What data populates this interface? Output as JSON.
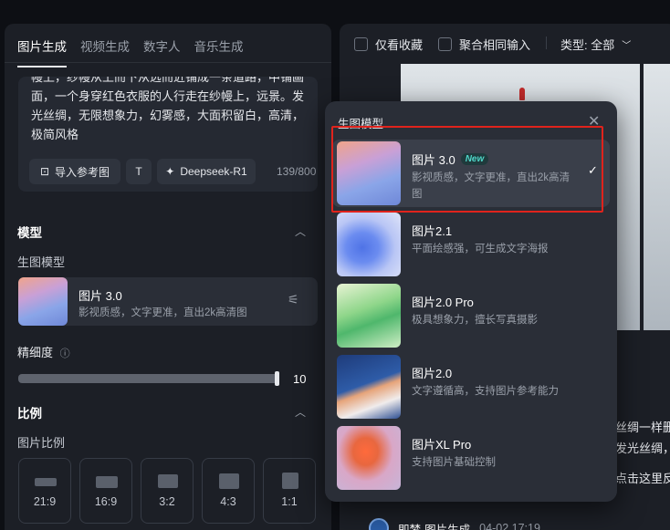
{
  "tabs": [
    "图片生成",
    "视频生成",
    "数字人",
    "音乐生成"
  ],
  "prompt": {
    "text": "幔上，纱幔从上而下从远而近铺成一条道路，中铺画面，一个身穿红色衣服的人行走在纱幔上，远景。发光丝绸，无限想象力，幻雾感，大面积留白，高清，极简风格",
    "import_label": "导入参考图",
    "model_label": "Deepseek-R1",
    "char_count": "139/800"
  },
  "model_section": {
    "title": "模型",
    "sub_label": "生图模型",
    "selected_name": "图片 3.0",
    "selected_desc": "影视质感，文字更准，直出2k高清图"
  },
  "detail": {
    "label": "精细度",
    "value": "10",
    "level_fraction": 0.95
  },
  "ratio_section": {
    "title": "比例",
    "sub_label": "图片比例",
    "ratios": [
      "21:9",
      "16:9",
      "3:2",
      "4:3",
      "1:1"
    ]
  },
  "right": {
    "filter_collect": "仅看收藏",
    "filter_merge": "聚合相同输入",
    "type_filter": "类型: 全部",
    "side_text_1": "丝绸一样删",
    "side_text_2": "发光丝绸，",
    "side_text_3": "点击这里反",
    "footer_name": "即梦-图片生成",
    "footer_time": "04-02 17:19"
  },
  "popup": {
    "title": "生图模型",
    "new_badge": "New",
    "options": [
      {
        "name": "图片 3.0",
        "desc": "影视质感，文字更准，直出2k高清图",
        "selected": true
      },
      {
        "name": "图片2.1",
        "desc": "平面绘感强，可生成文字海报"
      },
      {
        "name": "图片2.0 Pro",
        "desc": "极具想象力，擅长写真摄影"
      },
      {
        "name": "图片2.0",
        "desc": "文字遵循高，支持图片参考能力"
      },
      {
        "name": "图片XL Pro",
        "desc": "支持图片基础控制"
      }
    ]
  },
  "colors": {
    "panel_bg": "#1c1f26",
    "popup_bg": "#2a2e37",
    "accent_new": "#4fd6c8",
    "highlight": "#e0231c"
  }
}
